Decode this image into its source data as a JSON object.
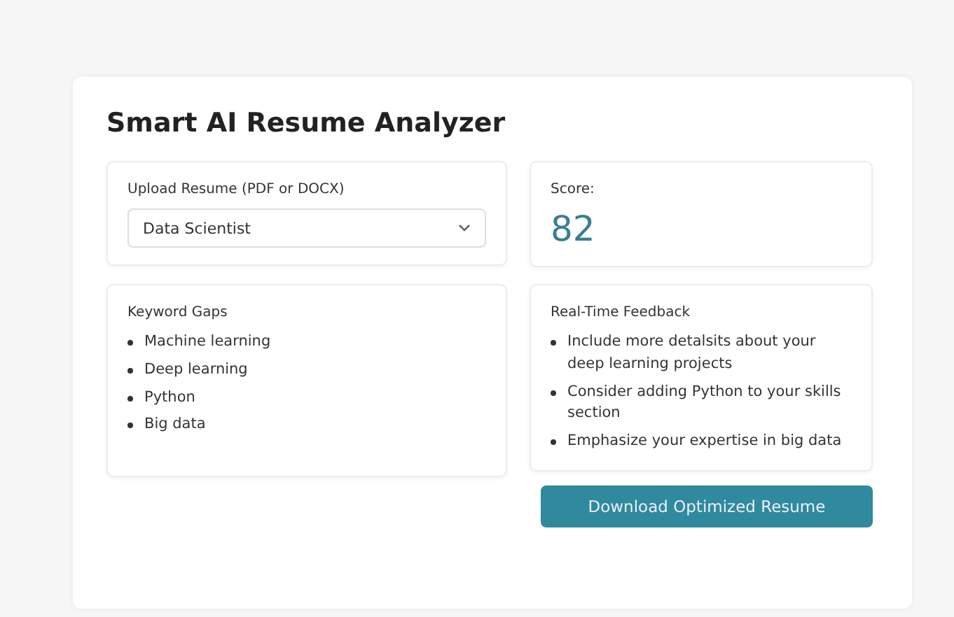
{
  "title": "Smart AI Resume Analyzer",
  "upload": {
    "label": "Upload Resume (PDF or DOCX)",
    "value": "Data Scientist"
  },
  "score": {
    "label": "Score:",
    "value": "82"
  },
  "keyword_gaps": {
    "title": "Keyword Gaps",
    "items": [
      "Machine learning",
      "Deep learning",
      "Python",
      "Big data"
    ]
  },
  "feedback": {
    "title": "Real-Time Feedback",
    "items": [
      "Include more detalsits about your deep learning projects",
      "Consider adding Python to your skills section",
      "Emphasize your expertise in big data"
    ]
  },
  "button": "Download Optimized Resume"
}
